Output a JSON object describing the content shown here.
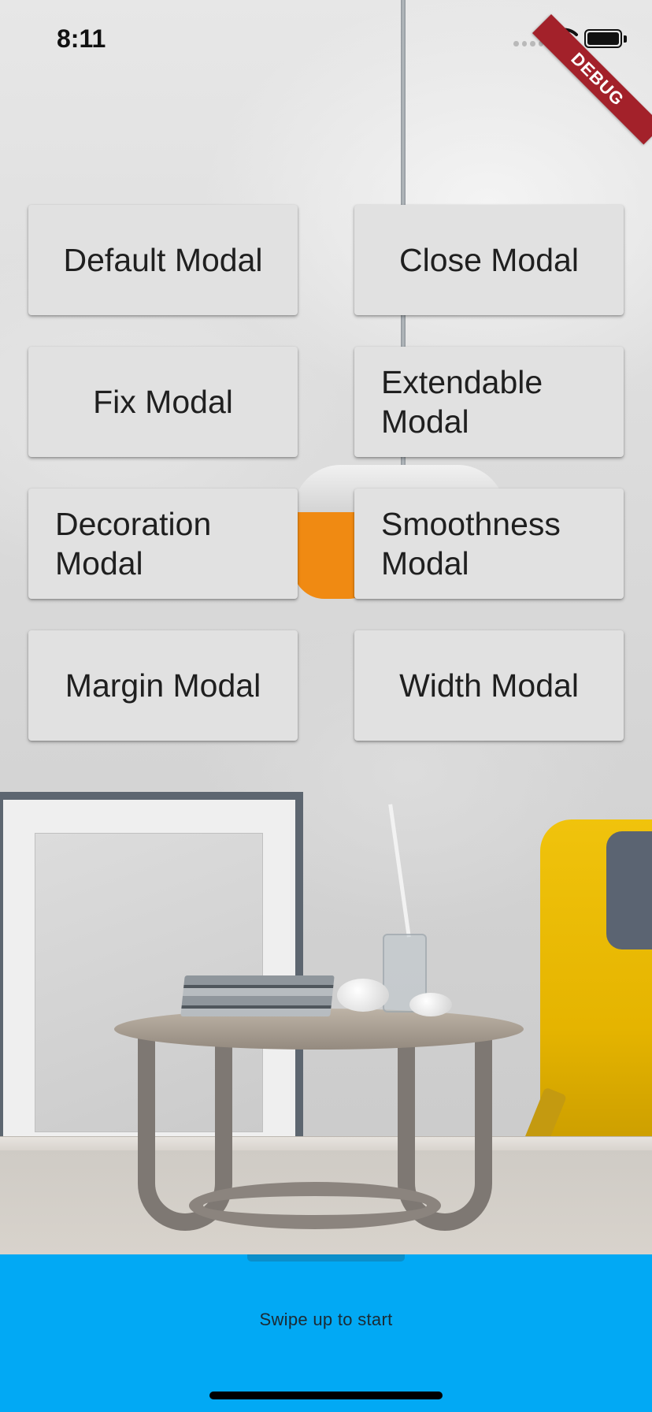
{
  "status_bar": {
    "time": "8:11",
    "debug_banner": "DEBUG",
    "icons": [
      "signal-dots-icon",
      "wifi-icon",
      "battery-icon"
    ]
  },
  "modal_buttons": {
    "default_modal": "Default Modal",
    "close_modal": "Close Modal",
    "fix_modal": "Fix Modal",
    "extendable_modal": "Extendable Modal",
    "decoration_modal": "Decoration Modal",
    "smoothness_modal": "Smoothness Modal",
    "margin_modal": "Margin Modal",
    "width_modal": "Width Modal"
  },
  "bottom_panel": {
    "prompt": "Swipe up to start",
    "color": "#02a9f4"
  },
  "colors": {
    "button_bg": "#e1e1e1",
    "debug_banner": "#a3212a"
  }
}
